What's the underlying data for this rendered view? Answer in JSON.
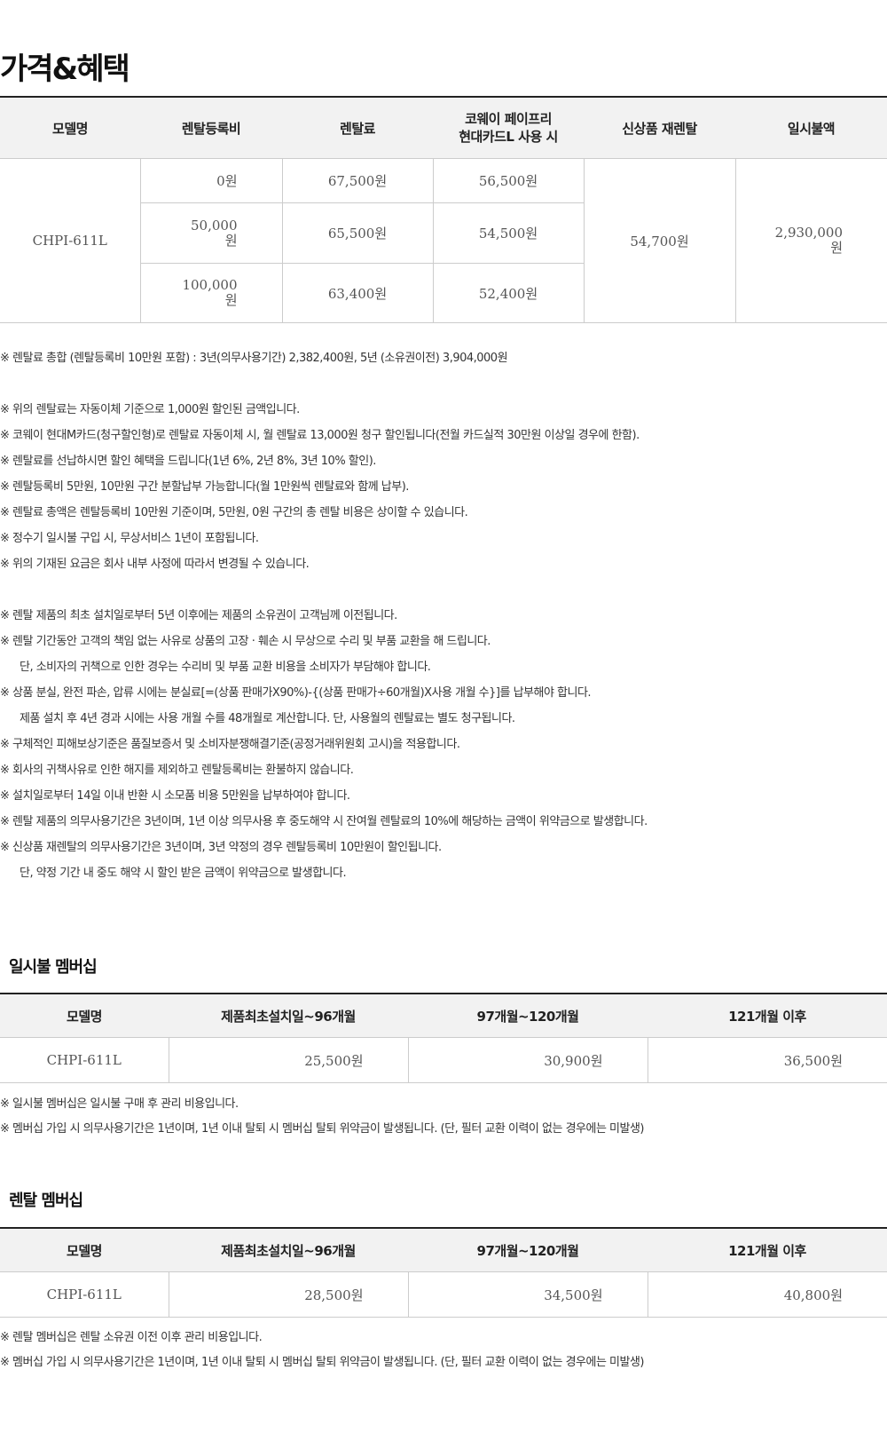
{
  "page_title": "가격&혜택",
  "price_table": {
    "headers": [
      "모델명",
      "렌탈등록비",
      "렌탈료",
      "코웨이 페이프리\n현대카드L 사용 시",
      "신상품 재렌탈",
      "일시불액"
    ],
    "model": "CHPI-611L",
    "rows": [
      {
        "reg_fee": "0원",
        "rental": "67,500원",
        "card": "56,500원"
      },
      {
        "reg_fee": "50,000\n원",
        "rental": "65,500원",
        "card": "54,500원"
      },
      {
        "reg_fee": "100,000\n원",
        "rental": "63,400원",
        "card": "52,400원"
      }
    ],
    "re_rental": "54,700원",
    "lump_sum": "2,930,000\n원"
  },
  "notes": [
    "※  렌탈료 총합 (렌탈등록비 10만원 포함) : 3년(의무사용기간) 2,382,400원, 5년 (소유권이전) 3,904,000원",
    "",
    "※  위의 렌탈료는 자동이체 기준으로 1,000원 할인된 금액입니다.",
    "※  코웨이 현대M카드(청구할인형)로 렌탈료 자동이체 시, 월 렌탈료 13,000원 청구 할인됩니다(전월 카드실적 30만원 이상일 경우에 한함).",
    "※  렌탈료를 선납하시면 할인 혜택을 드립니다(1년 6%, 2년 8%, 3년 10% 할인).",
    "※  렌탈등록비 5만원, 10만원 구간 분할납부 가능합니다(월 1만원씩 렌탈료와 함께 납부).",
    "※  렌탈료 총액은 렌탈등록비 10만원 기준이며, 5만원, 0원 구간의 총 렌탈 비용은 상이할 수 있습니다.",
    "※  정수기 일시불 구입 시, 무상서비스 1년이 포함됩니다.",
    "※  위의 기재된 요금은 회사 내부 사정에 따라서 변경될 수 있습니다.",
    "",
    "※  렌탈 제품의 최초 설치일로부터 5년 이후에는 제품의 소유권이 고객님께 이전됩니다.",
    "※  렌탈 기간동안 고객의 책임 없는 사유로 상품의 고장 · 훼손 시 무상으로 수리 및 부품 교환을 해 드립니다.",
    "단, 소비자의 귀책으로 인한 경우는 수리비 및 부품 교환 비용을 소비자가 부담해야 합니다.",
    "※  상품 분실, 완전 파손, 압류 시에는 분실료[=(상품 판매가X90%)-{(상품 판매가÷60개월)X사용 개월 수}]를 납부해야 합니다.",
    "제품 설치 후 4년 경과 시에는 사용 개월 수를 48개월로 계산합니다. 단, 사용월의 렌탈료는 별도 청구됩니다.",
    "※  구체적인 피해보상기준은 품질보증서 및 소비자분쟁해결기준(공정거래위원회 고시)을 적용합니다.",
    "※  회사의 귀책사유로 인한 해지를 제외하고 렌탈등록비는 환불하지 않습니다.",
    "※  설치일로부터 14일 이내 반환 시 소모품 비용 5만원을 납부하여야 합니다.",
    "※  렌탈 제품의 의무사용기간은 3년이며, 1년 이상 의무사용 후 중도해약 시 잔여월 렌탈료의 10%에 해당하는 금액이 위약금으로 발생합니다.",
    "※  신상품 재렌탈의 의무사용기간은 3년이며, 3년 약정의 경우 렌탈등록비 10만원이 할인됩니다.",
    "단, 약정 기간 내 중도 해약 시 할인 받은 금액이 위약금으로 발생합니다."
  ],
  "lump_membership": {
    "title": "일시불 멤버십",
    "headers": [
      "모델명",
      "제품최초설치일~96개월",
      "97개월~120개월",
      "121개월 이후"
    ],
    "model": "CHPI-611L",
    "values": [
      "25,500원",
      "30,900원",
      "36,500원"
    ],
    "notes": [
      "※ 일시불 멤버십은 일시불 구매 후 관리 비용입니다.",
      "※ 멤버십 가입 시 의무사용기간은 1년이며, 1년 이내 탈퇴 시 멤버십 탈퇴 위약금이 발생됩니다. (단, 필터 교환 이력이 없는 경우에는 미발생)"
    ]
  },
  "rental_membership": {
    "title": "렌탈 멤버십",
    "headers": [
      "모델명",
      "제품최초설치일~96개월",
      "97개월~120개월",
      "121개월 이후"
    ],
    "model": "CHPI-611L",
    "values": [
      "28,500원",
      "34,500원",
      "40,800원"
    ],
    "notes": [
      "※ 렌탈 멤버십은 렌탈 소유권 이전 이후 관리 비용입니다.",
      "※ 멤버십 가입 시 의무사용기간은 1년이며, 1년 이내 탈퇴 시 멤버십 탈퇴 위약금이 발생됩니다. (단, 필터 교환 이력이 없는 경우에는 미발생)"
    ]
  }
}
